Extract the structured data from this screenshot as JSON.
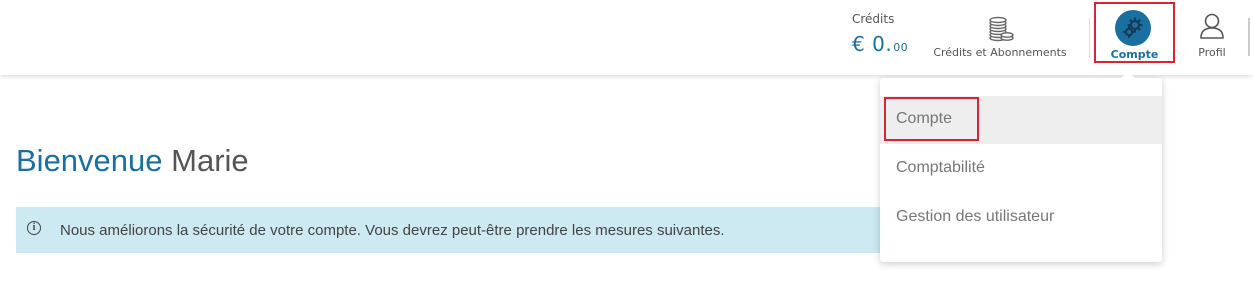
{
  "header": {
    "credits_label": "Crédits",
    "credits_currency": "€",
    "credits_whole": "0.",
    "credits_cents": "00",
    "subscriptions_label": "Crédits et Abonnements",
    "account_label": "Compte",
    "profile_label": "Profil"
  },
  "main": {
    "welcome_word": "Bienvenue",
    "user_name": "Marie",
    "notice_text": "Nous améliorons la sécurité de votre compte. Vous devrez peut-être prendre les mesures suivantes."
  },
  "dropdown": {
    "items": [
      {
        "label": "Compte"
      },
      {
        "label": "Comptabilité"
      },
      {
        "label": "Gestion des utilisateur"
      }
    ]
  },
  "icons": {
    "subscriptions": "coins-icon",
    "account": "gears-icon",
    "profile": "user-icon",
    "notice": "info-icon"
  },
  "colors": {
    "accent": "#1a6fa0",
    "highlight_border": "#d9252f",
    "notice_bg": "#cde9f1"
  }
}
